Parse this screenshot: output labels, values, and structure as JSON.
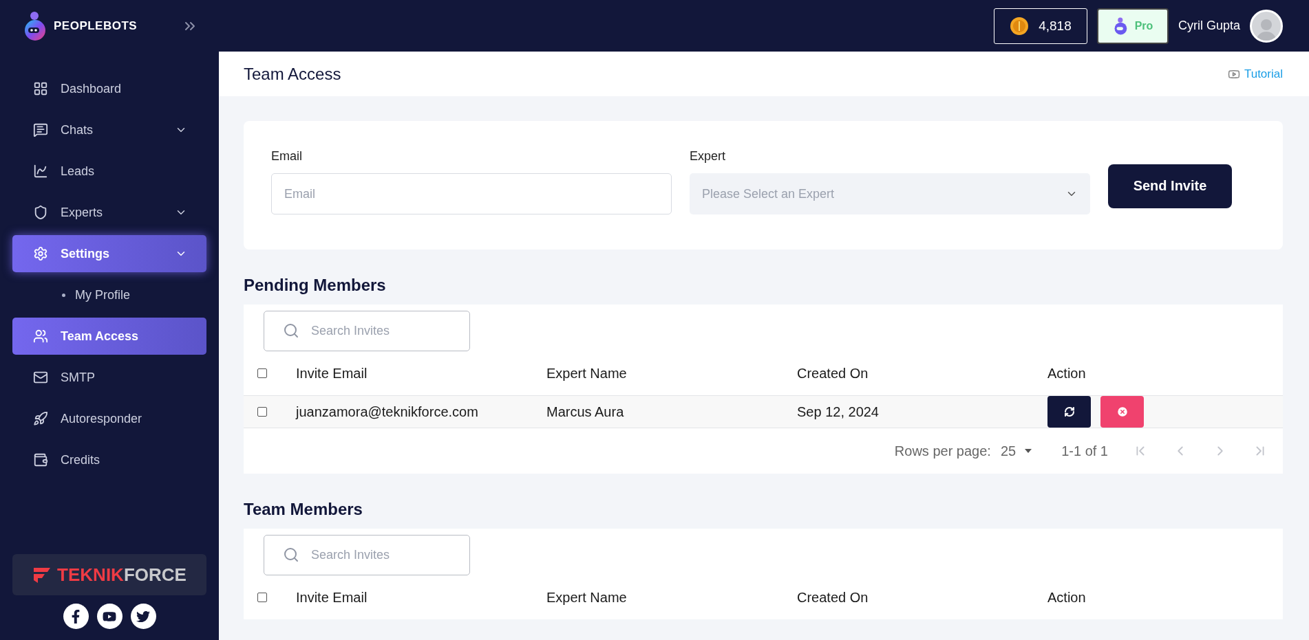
{
  "brand": {
    "name": "PEOPLEBOTS"
  },
  "header": {
    "credits": "4,818",
    "plan": "Pro",
    "user": "Cyril Gupta"
  },
  "sidebar": {
    "items": [
      {
        "label": "Dashboard",
        "kind": "item",
        "expandable": false,
        "selected": false
      },
      {
        "label": "Chats",
        "kind": "item",
        "expandable": true,
        "selected": false
      },
      {
        "label": "Leads",
        "kind": "item",
        "expandable": false,
        "selected": false
      },
      {
        "label": "Experts",
        "kind": "item",
        "expandable": true,
        "selected": false
      },
      {
        "label": "Settings",
        "kind": "group",
        "expandable": true,
        "selected": true
      },
      {
        "label": "My Profile",
        "kind": "subitem",
        "expandable": false,
        "selected": false
      },
      {
        "label": "Team Access",
        "kind": "item",
        "expandable": false,
        "selected": true
      },
      {
        "label": "SMTP",
        "kind": "item",
        "expandable": false,
        "selected": false
      },
      {
        "label": "Autoresponder",
        "kind": "item",
        "expandable": false,
        "selected": false
      },
      {
        "label": "Credits",
        "kind": "item",
        "expandable": false,
        "selected": false
      }
    ],
    "partner": {
      "prefix": "TEKNIK",
      "suffix": "FORCE"
    }
  },
  "page": {
    "title": "Team Access",
    "tutorial": "Tutorial"
  },
  "invite_form": {
    "email_label": "Email",
    "email_placeholder": "Email",
    "expert_label": "Expert",
    "expert_placeholder": "Please Select an Expert",
    "button": "Send Invite"
  },
  "sections": [
    {
      "title": "Pending Members",
      "search_placeholder": "Search Invites",
      "all_checked": false,
      "columns": [
        "Invite Email",
        "Expert Name",
        "Created On",
        "Action"
      ],
      "rows": [
        {
          "checked": false,
          "cells": [
            "juanzamora@teknikforce.com",
            "Marcus Aura",
            "Sep 12, 2024"
          ]
        }
      ],
      "pagination": {
        "label": "Rows per page:",
        "value": "25",
        "range": "1-1 of 1",
        "nav_disabled": true
      }
    },
    {
      "title": "Team Members",
      "search_placeholder": "Search Invites",
      "all_checked": false,
      "columns": [
        "Invite Email",
        "Expert Name",
        "Created On",
        "Action"
      ]
    }
  ]
}
